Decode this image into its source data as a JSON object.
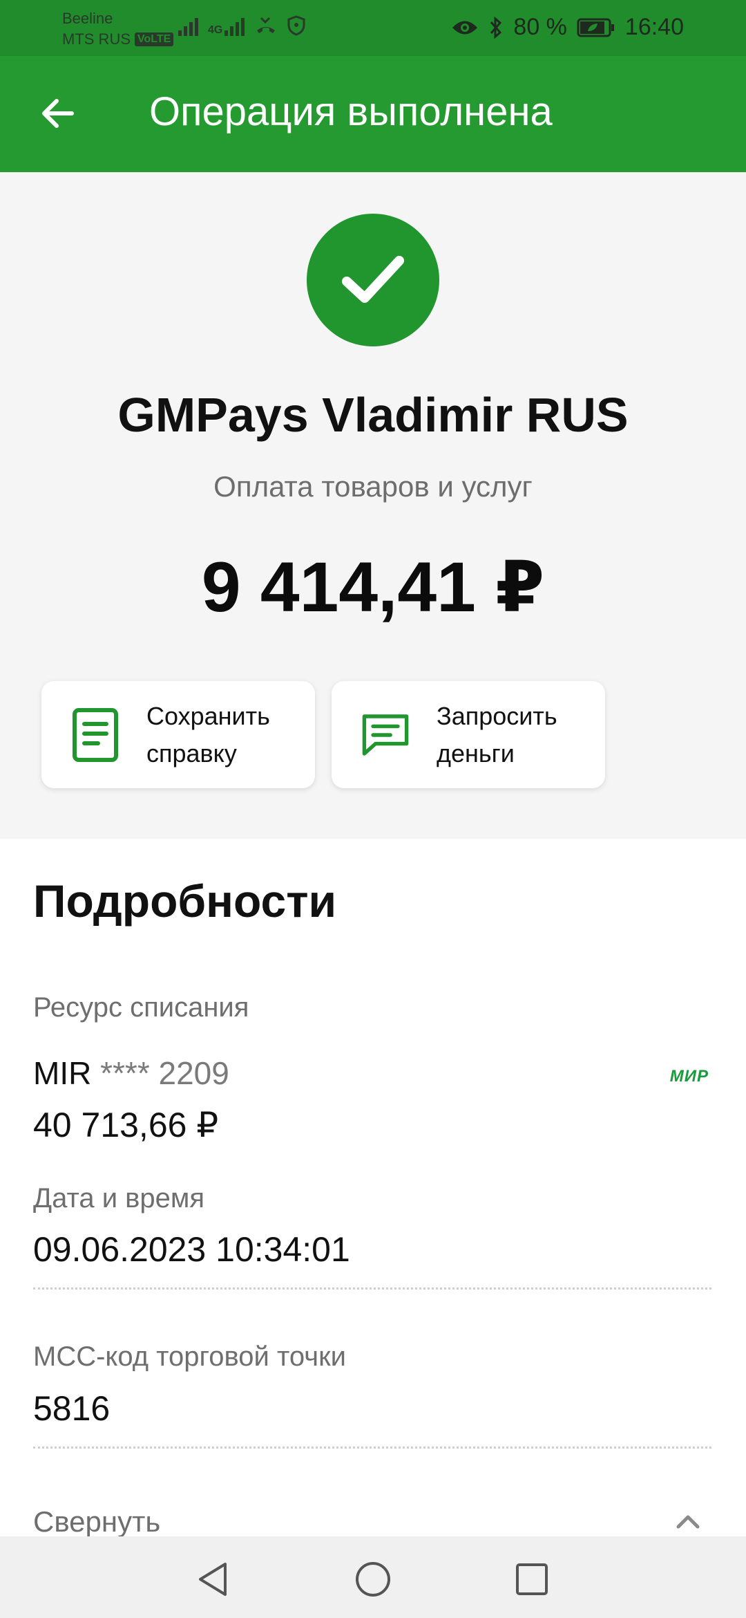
{
  "status_bar": {
    "carrier1": "Beeline",
    "carrier2": "MTS RUS",
    "volte": "VoLTE",
    "network": "4G",
    "battery": "80 %",
    "time": "16:40"
  },
  "app_bar": {
    "title": "Операция выполнена",
    "back_icon": "arrow-left-icon"
  },
  "result": {
    "merchant": "GMPays Vladimir RUS",
    "operation_type": "Оплата товаров и услуг",
    "amount": "9 414,41 ₽"
  },
  "actions": [
    {
      "label": "Сохранить\nсправку",
      "icon": "document-icon"
    },
    {
      "label": "Запросить\nденьги",
      "icon": "message-icon"
    }
  ],
  "details": {
    "title": "Подробности",
    "source_label": "Ресурс списания",
    "card_brand": "MIR",
    "card_mask": "**** 2209",
    "card_logo": "МИР",
    "card_balance": "40 713,66 ₽",
    "datetime_label": "Дата и время",
    "datetime_value": "09.06.2023 10:34:01",
    "mcc_label": "MCC-код торговой точки",
    "mcc_value": "5816",
    "collapse_label": "Свернуть"
  },
  "colors": {
    "accent": "#21962f",
    "appbar": "#249a30",
    "statusbar": "#218c2c"
  }
}
